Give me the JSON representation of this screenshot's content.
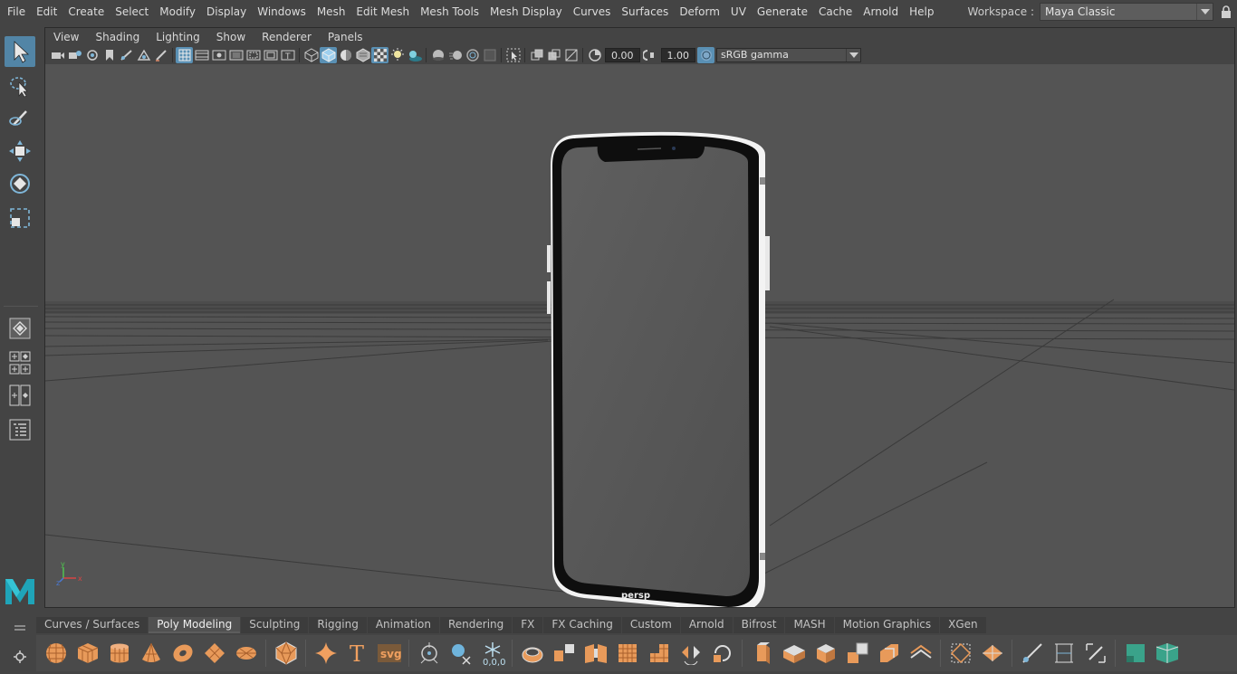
{
  "menubar": {
    "items": [
      "File",
      "Edit",
      "Create",
      "Select",
      "Modify",
      "Display",
      "Windows",
      "Mesh",
      "Edit Mesh",
      "Mesh Tools",
      "Mesh Display",
      "Curves",
      "Surfaces",
      "Deform",
      "UV",
      "Generate",
      "Cache",
      "Arnold",
      "Help"
    ]
  },
  "workspace": {
    "label": "Workspace :",
    "value": "Maya Classic"
  },
  "panel_menu": {
    "items": [
      "View",
      "Shading",
      "Lighting",
      "Show",
      "Renderer",
      "Panels"
    ]
  },
  "panel_toolbar": {
    "exposure": "0.00",
    "gamma": "1.00",
    "color_space": "sRGB gamma"
  },
  "viewport": {
    "camera_label": "persp",
    "axis_labels": {
      "x": "x",
      "y": "y",
      "z": "z"
    }
  },
  "shelf": {
    "tabs": [
      "Curves / Surfaces",
      "Poly Modeling",
      "Sculpting",
      "Rigging",
      "Animation",
      "Rendering",
      "FX",
      "FX Caching",
      "Custom",
      "Arnold",
      "Bifrost",
      "MASH",
      "Motion Graphics",
      "XGen"
    ],
    "active_tab": "Poly Modeling",
    "svg_label": "svg",
    "text_label": "T",
    "origin_label": "0,0,0"
  },
  "colors": {
    "ui_bg": "#444444",
    "viewport_bg": "#545454",
    "accent_blue": "#5285a6",
    "shelf_orange": "#f0a060",
    "shelf_teal": "#3aa38a"
  }
}
